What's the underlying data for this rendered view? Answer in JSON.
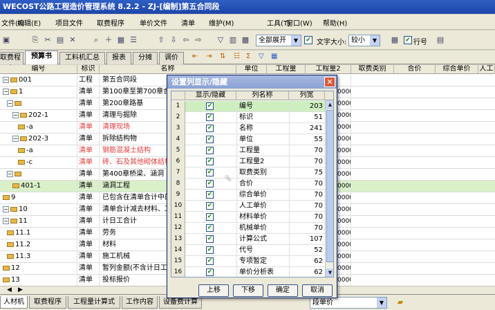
{
  "window": {
    "title": "WECOST公路工程造价管理系统 8.2.2 - ZJ-[编制]第五合同段"
  },
  "menu": [
    "文件(F)",
    "编辑(E)",
    "项目文件",
    "取费程序",
    "单价文件",
    "清单",
    "维护(M)",
    "工具(T)",
    "窗口(W)",
    "帮助(H)"
  ],
  "toolbar": {
    "expand_label": "全部展开",
    "font_size_label": "文字大小:",
    "font_size_value": "较小",
    "row_num_label": "行号"
  },
  "tabs": [
    "取费程序",
    "预算书",
    "工料机汇总",
    "报表",
    "分摊",
    "调价"
  ],
  "grid": {
    "headers": [
      "编号",
      "标识",
      "名称",
      "单位",
      "工程量",
      "工程量2",
      "取费类别",
      "合价",
      "综合单价",
      "人工"
    ],
    "rows": [
      {
        "code": "001",
        "tag": "工程",
        "name": "第五合同段",
        "qty2": ""
      },
      {
        "code": "1",
        "tag": "清单",
        "name": "第100章至第700章合计",
        "qty2": "0000"
      },
      {
        "code": "",
        "tag": "清单",
        "name": "第200章路基",
        "qty2": "0000"
      },
      {
        "code": "202-1",
        "tag": "清单",
        "name": "清理与掘除",
        "qty2": "0000"
      },
      {
        "code": "-a",
        "tag": "清单",
        "name": "清理现场",
        "qty2": "0000"
      },
      {
        "code": "202-3",
        "tag": "清单",
        "name": "拆除结构物",
        "qty2": "0000"
      },
      {
        "code": "-a",
        "tag": "清单",
        "name": "钢筋混凝土结构",
        "qty2": "0000"
      },
      {
        "code": "-c",
        "tag": "清单",
        "name": "砖、石及其他砌体结构",
        "qty2": "0000"
      },
      {
        "code": "",
        "tag": "清单",
        "name": "第400章桥梁、涵洞",
        "qty2": "0000"
      },
      {
        "code": "401-1",
        "tag": "清单",
        "name": "涵洞工程",
        "qty2": "0000"
      },
      {
        "code": "9",
        "tag": "清单",
        "name": "已包含在清单合计中的",
        "qty2": "0000"
      },
      {
        "code": "10",
        "tag": "清单",
        "name": "清单合计减去材料、工",
        "qty2": "0000"
      },
      {
        "code": "11",
        "tag": "清单",
        "name": "计日工合计",
        "qty2": "0000"
      },
      {
        "code": "11.1",
        "tag": "清单",
        "name": "劳务",
        "qty2": "0000"
      },
      {
        "code": "11.2",
        "tag": "清单",
        "name": "材料",
        "qty2": "0000"
      },
      {
        "code": "11.3",
        "tag": "清单",
        "name": "施工机械",
        "qty2": "0000"
      },
      {
        "code": "12",
        "tag": "清单",
        "name": "暂列金额(不含计日工",
        "qty2": "0000"
      },
      {
        "code": "13",
        "tag": "清单",
        "name": "投标报价",
        "qty2": "0000"
      }
    ]
  },
  "bottom_tabs": [
    "人材机",
    "取费程序",
    "工程量计算式",
    "工作内容",
    "设备费计算"
  ],
  "bottom_select": "段单价",
  "dialog": {
    "title": "设置列显示/隐藏",
    "headers": [
      "显示/隐藏",
      "列名称",
      "列宽"
    ],
    "rows": [
      {
        "n": "1",
        "name": "编号",
        "width": "203"
      },
      {
        "n": "2",
        "name": "标识",
        "width": "51"
      },
      {
        "n": "3",
        "name": "名称",
        "width": "241"
      },
      {
        "n": "4",
        "name": "单位",
        "width": "55"
      },
      {
        "n": "5",
        "name": "工程量",
        "width": "70"
      },
      {
        "n": "6",
        "name": "工程量2",
        "width": "70"
      },
      {
        "n": "7",
        "name": "取费类别",
        "width": "75"
      },
      {
        "n": "8",
        "name": "合价",
        "width": "70"
      },
      {
        "n": "9",
        "name": "综合单价",
        "width": "70"
      },
      {
        "n": "10",
        "name": "人工单价",
        "width": "70"
      },
      {
        "n": "11",
        "name": "材料单价",
        "width": "70"
      },
      {
        "n": "12",
        "name": "机械单价",
        "width": "70"
      },
      {
        "n": "13",
        "name": "计算公式",
        "width": "107"
      },
      {
        "n": "14",
        "name": "代号",
        "width": "52"
      },
      {
        "n": "15",
        "name": "专项暂定",
        "width": "62"
      },
      {
        "n": "16",
        "name": "单价分析表",
        "width": "62"
      }
    ],
    "buttons": {
      "up": "上移",
      "down": "下移",
      "ok": "确定",
      "cancel": "取消"
    }
  },
  "colors": {
    "title_bar": "#2f5fc4",
    "selected_row": "#d9f0c9",
    "red_text": "#e03c3c"
  }
}
